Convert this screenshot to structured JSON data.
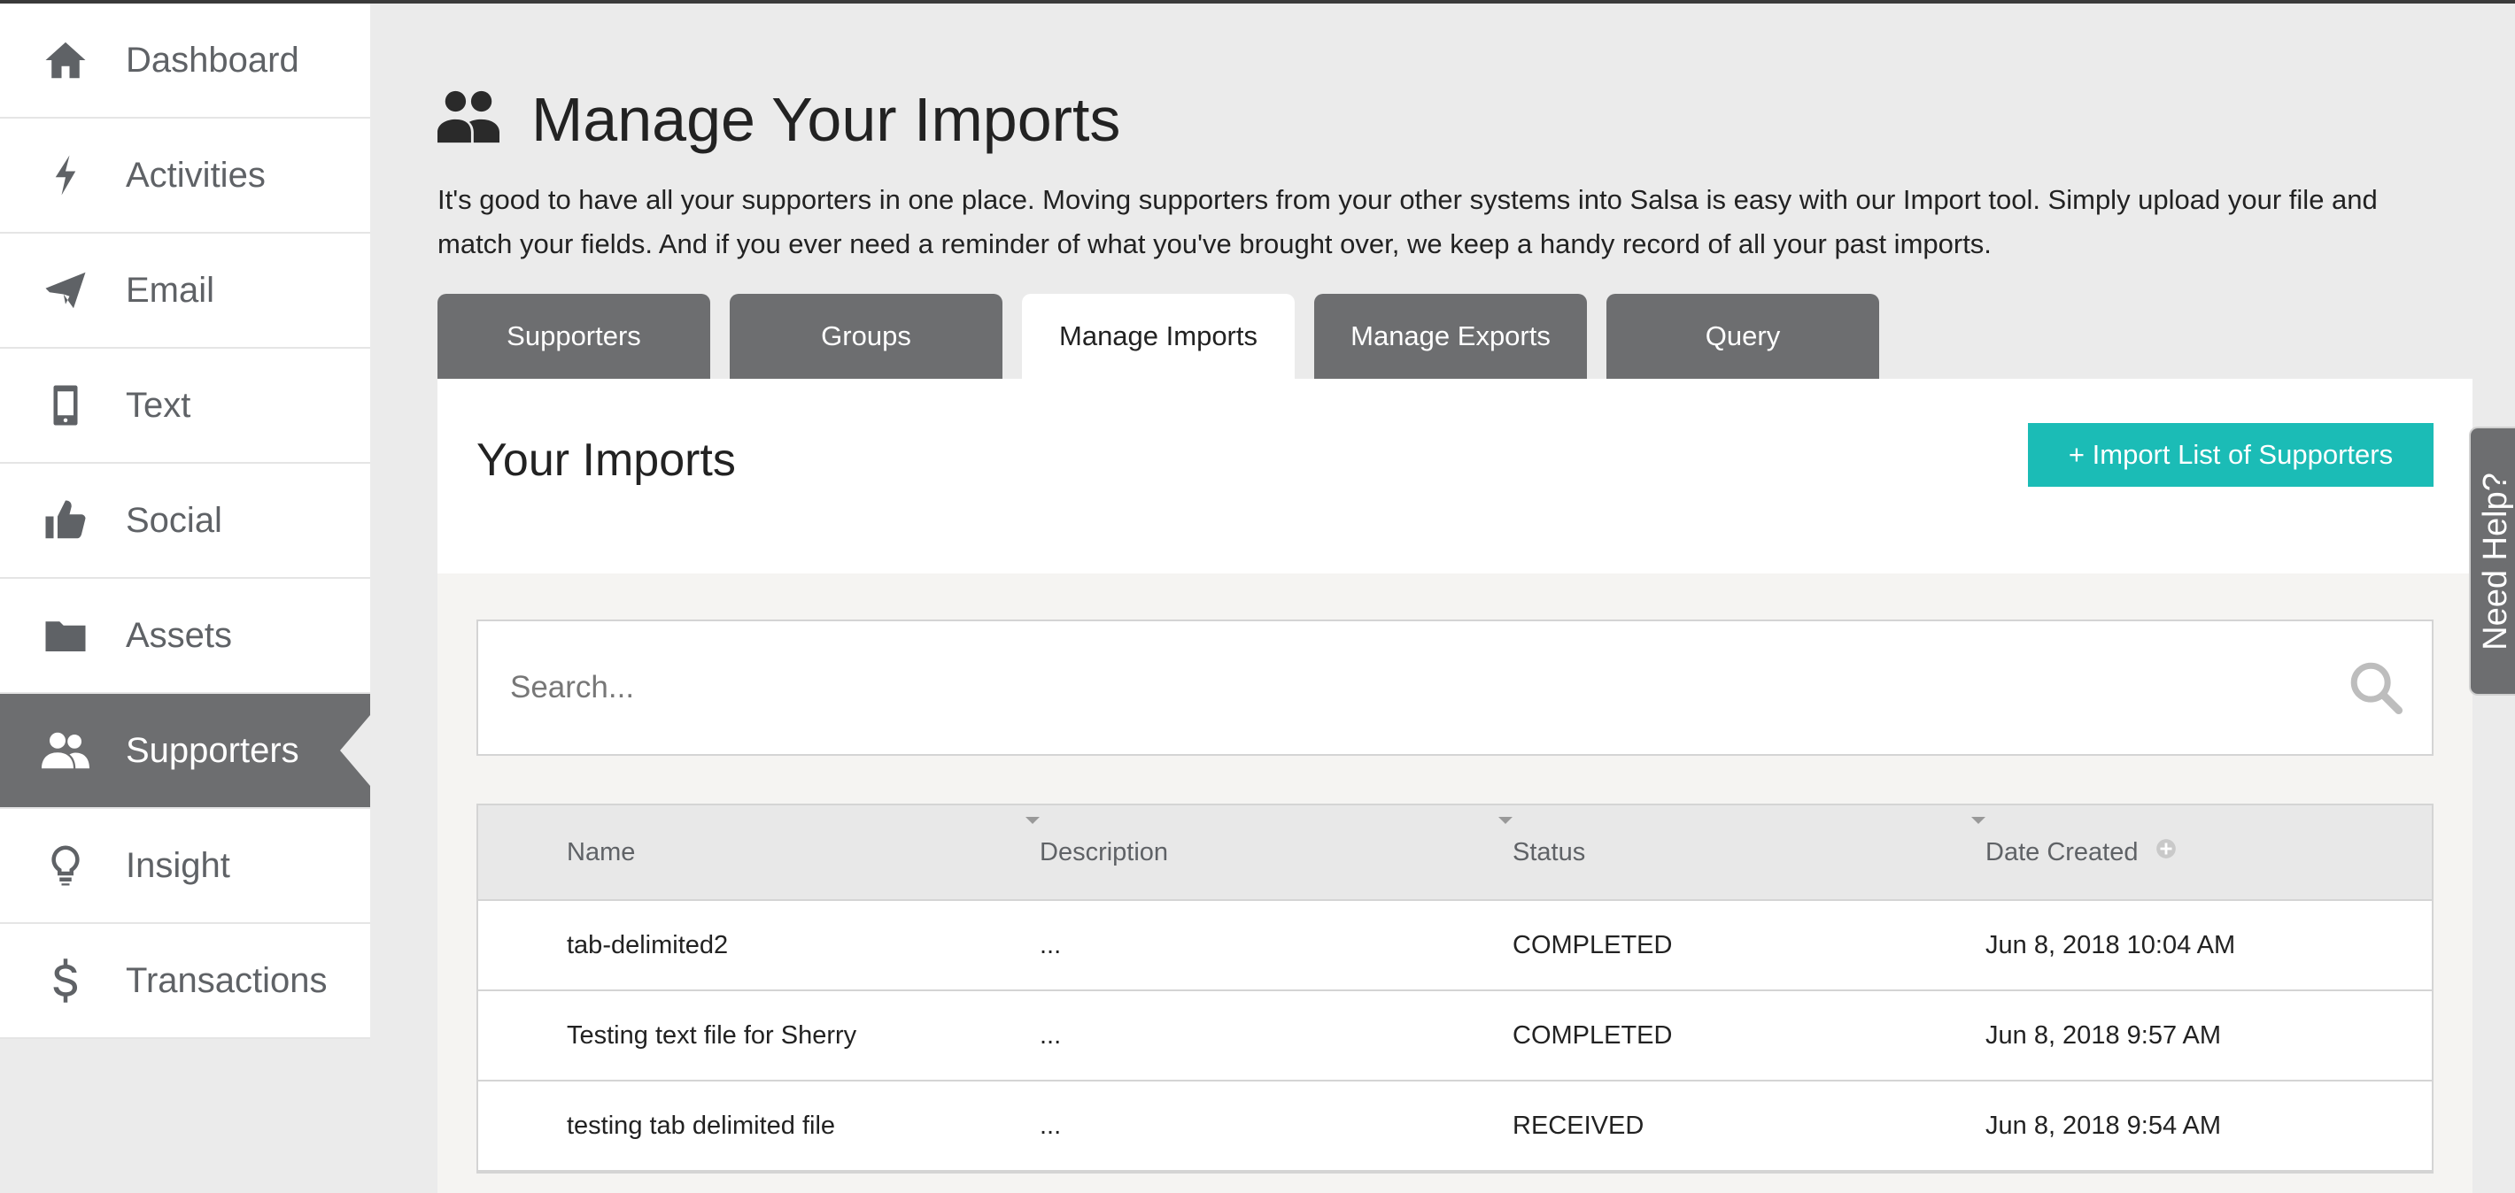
{
  "sidebar": {
    "items": [
      {
        "label": "Dashboard",
        "icon": "home-icon"
      },
      {
        "label": "Activities",
        "icon": "lightning-icon"
      },
      {
        "label": "Email",
        "icon": "paper-plane-icon"
      },
      {
        "label": "Text",
        "icon": "mobile-phone-icon"
      },
      {
        "label": "Social",
        "icon": "thumbs-up-icon"
      },
      {
        "label": "Assets",
        "icon": "folder-icon"
      },
      {
        "label": "Supporters",
        "icon": "users-icon",
        "active": true
      },
      {
        "label": "Insight",
        "icon": "lightbulb-icon"
      },
      {
        "label": "Transactions",
        "icon": "dollar-icon"
      }
    ]
  },
  "header": {
    "title": "Manage Your Imports",
    "icon": "users-icon",
    "intro": "It's good to have all your supporters in one place. Moving supporters from your other systems into Salsa is easy with our Import tool. Simply upload your file and match your fields. And if you ever need a reminder of what you've brought over, we keep a handy record of all your past imports."
  },
  "tabs": [
    {
      "label": "Supporters",
      "active": false
    },
    {
      "label": "Groups",
      "active": false
    },
    {
      "label": "Manage Imports",
      "active": true
    },
    {
      "label": "Manage Exports",
      "active": false
    },
    {
      "label": "Query",
      "active": false
    }
  ],
  "panel": {
    "title": "Your Imports",
    "import_button": "+ Import List of Supporters"
  },
  "search": {
    "placeholder": "Search..."
  },
  "table": {
    "headers": [
      "Name",
      "Description",
      "Status",
      "Date Created"
    ],
    "rows": [
      {
        "name": "tab-delimited2",
        "description": "...",
        "status": "COMPLETED",
        "date": "Jun 8, 2018 10:04 AM"
      },
      {
        "name": "Testing text file for Sherry",
        "description": "...",
        "status": "COMPLETED",
        "date": "Jun 8, 2018 9:57 AM"
      },
      {
        "name": "testing tab delimited file",
        "description": "...",
        "status": "RECEIVED",
        "date": "Jun 8, 2018 9:54 AM"
      }
    ]
  },
  "help_tab": {
    "label": "Need Help?"
  },
  "colors": {
    "accent": "#1bbcb6",
    "sidebar_active": "#6d6e70",
    "background": "#ebebeb"
  }
}
